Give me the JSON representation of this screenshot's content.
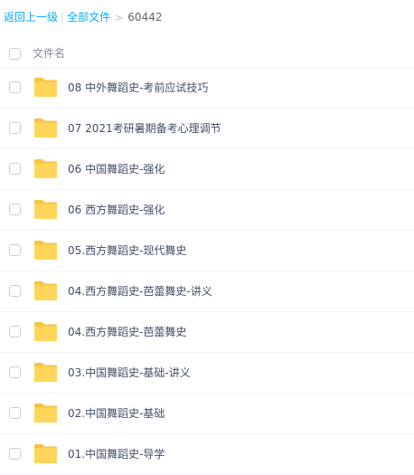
{
  "breadcrumb": {
    "back_label": "返回上一级",
    "separator": "|",
    "root_label": "全部文件",
    "arrow": ">",
    "current_label": "60442"
  },
  "list_header": {
    "column_name": "文件名"
  },
  "files": [
    {
      "name": "08 中外舞蹈史-考前应试技巧",
      "icon": "folder-icon"
    },
    {
      "name": "07 2021考研暑期备考心理调节",
      "icon": "folder-icon"
    },
    {
      "name": "06 中国舞蹈史-强化",
      "icon": "folder-icon"
    },
    {
      "name": "06 西方舞蹈史-强化",
      "icon": "folder-icon"
    },
    {
      "name": "05.西方舞蹈史-现代舞史",
      "icon": "folder-icon"
    },
    {
      "name": "04.西方舞蹈史-芭蕾舞史-讲义",
      "icon": "folder-icon"
    },
    {
      "name": "04.西方舞蹈史-芭蕾舞史",
      "icon": "folder-icon"
    },
    {
      "name": "03.中国舞蹈史-基础-讲义",
      "icon": "folder-icon"
    },
    {
      "name": "02.中国舞蹈史-基础",
      "icon": "folder-icon"
    },
    {
      "name": "01.中国舞蹈史-导学",
      "icon": "folder-icon"
    }
  ],
  "colors": {
    "link": "#09aaff",
    "folder_back": "#f5c442",
    "folder_front": "#ffd659",
    "text": "#424e67"
  }
}
